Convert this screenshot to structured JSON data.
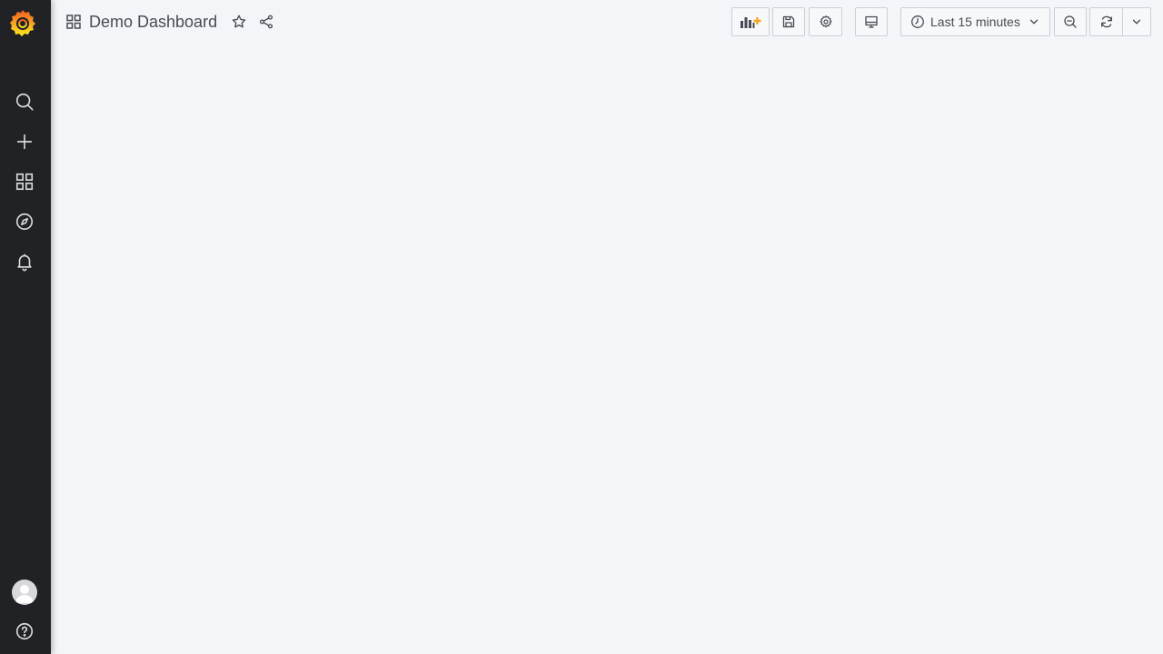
{
  "header": {
    "title": "Demo Dashboard"
  },
  "timepicker": {
    "label": "Last 15 minutes"
  },
  "icons": {
    "logo": "grafana-logo",
    "sidebar": [
      "search-icon",
      "plus-icon",
      "dashboards-icon",
      "explore-icon",
      "bell-icon",
      "avatar",
      "help-icon"
    ],
    "toolbar": [
      "add-panel-icon",
      "save-icon",
      "gear-icon",
      "tv-icon",
      "clock-icon",
      "chevron-down-icon",
      "zoom-out-icon",
      "refresh-icon",
      "chevron-down-icon"
    ]
  },
  "colors": {
    "sidebar_bg": "#202226",
    "page_bg": "#f4f5f8",
    "accent_orange": "#f5a623",
    "icon_gray": "#d8d9da",
    "text": "#464c54"
  }
}
